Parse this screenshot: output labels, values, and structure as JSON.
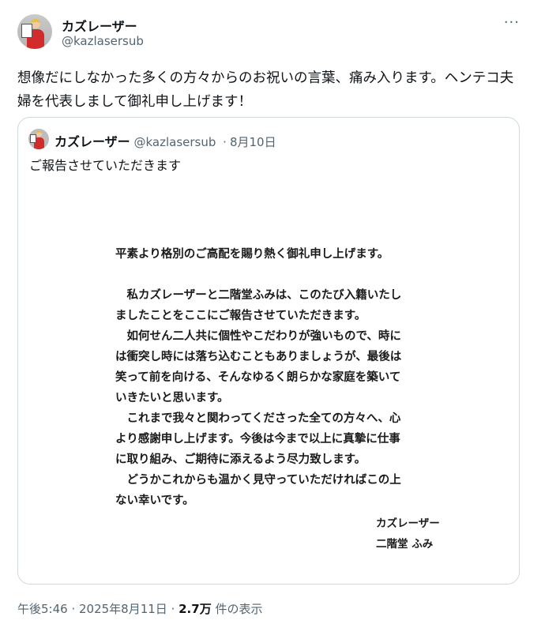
{
  "author": {
    "name": "カズレーザー",
    "handle": "@kazlasersub",
    "avatar_placard": "和令"
  },
  "tweet": {
    "text": "想像だにしなかった多くの方々からのお祝いの言葉、痛み入ります。ヘンテコ夫婦を代表しまして御礼申し上げます！"
  },
  "quote": {
    "name": "カズレーザー",
    "handle": "@kazlasersub",
    "separator": "·",
    "date": "8月10日",
    "text": "ご報告させていただきます",
    "letter": {
      "line1": "平素より格別のご高配を賜り熱く御礼申し上げます。",
      "para1": "　私カズレーザーと二階堂ふみは、このたび入籍いたし\nましたことをここにご報告させていただきます。",
      "para2": "　如何せん二人共に個性やこだわりが強いもので、時に\nは衝突し時には落ち込むこともありましょうが、最後は\n笑って前を向ける、そんなゆるく朗らかな家庭を築いて\nいきたいと思います。",
      "para3": "　これまで我々と関わってくださった全ての方々へ、心\nより感謝申し上げます。今後は今まで以上に真摯に仕事\nに取り組み、ご期待に添えるよう尽力致します。",
      "para4": "　どうかこれからも温かく見守っていただければこの上\nない幸いです。",
      "sign1": "カズレーザー",
      "sign2": "二階堂 ふみ"
    }
  },
  "footer": {
    "time": "午後5:46",
    "sep1": " · ",
    "date": "2025年8月11日",
    "sep2": " · ",
    "views": "2.7万",
    "views_label": " 件の表示"
  },
  "icons": {
    "more": "more-horizontal-icon"
  },
  "colors": {
    "text": "#0f1419",
    "secondary": "#536471",
    "border": "#cfd9de"
  }
}
